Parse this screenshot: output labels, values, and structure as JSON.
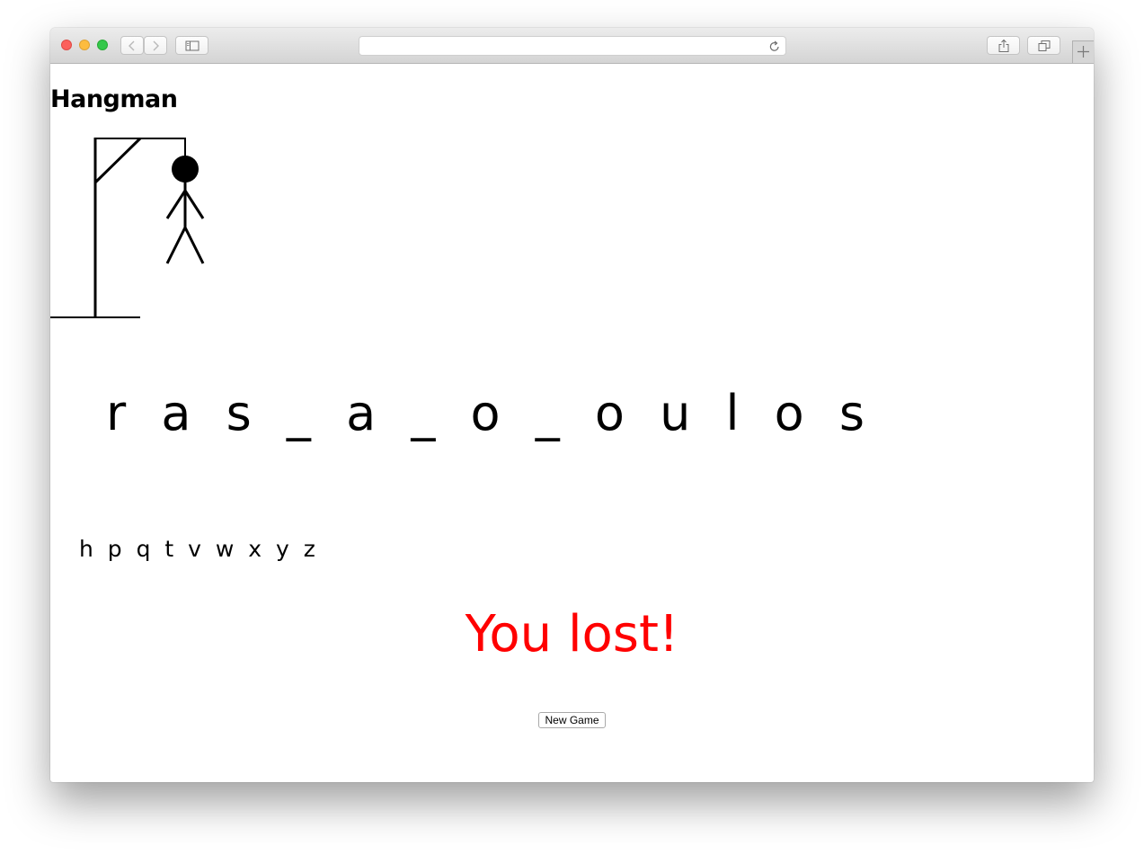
{
  "browser": {
    "icons": {
      "back": "chevron-left-icon",
      "forward": "chevron-right-icon",
      "sidebar": "sidebar-icon",
      "reload": "reload-icon",
      "share": "share-icon",
      "tabs": "tabs-overview-icon",
      "new_tab": "plus-icon"
    }
  },
  "page": {
    "title": "Hangman",
    "word": "r a s _ a _ o _ o u l o s",
    "wrong_guesses": "h p q t v w x y z",
    "result": "You lost!",
    "result_color": "#ff0000",
    "new_game_label": "New Game"
  }
}
